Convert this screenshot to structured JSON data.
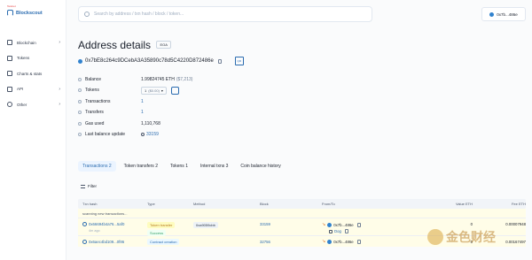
{
  "app": {
    "logo_badge": "Testnet",
    "logo_text": "Blockscout"
  },
  "sidebar": {
    "items": [
      {
        "label": "Blockchain",
        "has_chevron": true
      },
      {
        "label": "Tokens",
        "has_chevron": false
      },
      {
        "label": "Charts & stats",
        "has_chevron": false
      },
      {
        "label": "API",
        "has_chevron": true
      },
      {
        "label": "Other",
        "has_chevron": true
      }
    ],
    "chevron": "›"
  },
  "header": {
    "search_placeholder": "Search by address / txn hash / block / token...",
    "account": "0x7b...486e"
  },
  "page": {
    "title": "Address details",
    "badge": "EOA",
    "address": "0x7bE8c264c9DCebA3A35890c78d5C4220D872486e",
    "qr_label": "QR"
  },
  "details": {
    "balance_label": "Balance",
    "balance_value": "1.99824745 ETH",
    "balance_usd": "($7,213)",
    "tokens_label": "Tokens",
    "tokens_value": "1",
    "tokens_usd": "($0.00)",
    "transactions_label": "Transactions",
    "transactions_value": "1",
    "transfers_label": "Transfers",
    "transfers_value": "1",
    "gas_label": "Gas used",
    "gas_value": "1,110,768",
    "last_update_label": "Last balance update",
    "last_update_value": "33159"
  },
  "tabs": [
    {
      "label": "Transactions",
      "count": "2",
      "active": true
    },
    {
      "label": "Token transfers",
      "count": "2",
      "active": false
    },
    {
      "label": "Tokens",
      "count": "1",
      "active": false
    },
    {
      "label": "Internal txns",
      "count": "3",
      "active": false
    },
    {
      "label": "Coin balance history",
      "count": "",
      "active": false
    }
  ],
  "filter_label": "Filter",
  "table": {
    "headers": [
      "Txn hash",
      "Type",
      "Method",
      "Block",
      "From/To",
      "Value ETH",
      "Fee ETH"
    ],
    "scanning": "scanning new transactions...",
    "rows": [
      {
        "hash": "0x66694b4a76...5af0",
        "age": "4m ago",
        "type": "Token transfer",
        "status": "Success",
        "method": "0xa9059cbb",
        "block": "33159",
        "from": "0x7b...486e",
        "to": "Dog",
        "value": "0",
        "fee": "0.00007948"
      },
      {
        "hash": "0x6aec4bd109...0f86",
        "type": "Contract creation",
        "block": "32756",
        "from": "0x7b...486e",
        "value": "0",
        "fee": "0.00167497"
      }
    ]
  },
  "watermark": {
    "text": "金色财经"
  },
  "colors": {
    "accent": "#2b6cb0",
    "success": "#38a169",
    "warning": "#b7791f"
  }
}
